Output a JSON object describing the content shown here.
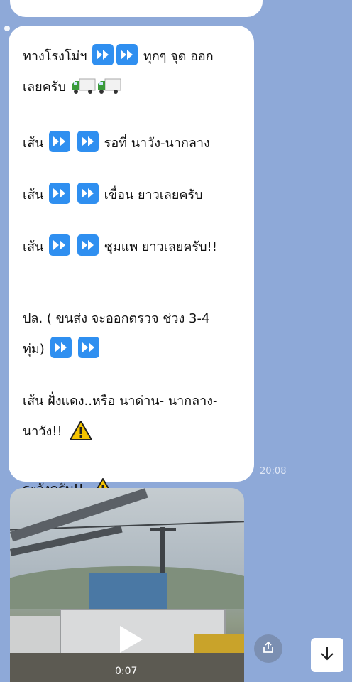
{
  "previous_message": {
    "partial_text": "",
    "time": ""
  },
  "message": {
    "line1_prefix": "ทางโรงโม่ฯ",
    "line1_suffix": "ทุกๆ จุด ออก",
    "line2": "เลยครับ",
    "route1_prefix": "เส้น",
    "route1_suffix": "รอที่ นาวัง-นากลาง",
    "route2_prefix": "เส้น",
    "route2_suffix": "เขื่อน ยาวเลยครับ",
    "route3_prefix": "เส้น",
    "route3_suffix": "ชุมแพ ยาวเลยครับ!!",
    "note_line1": "ปล. ( ขนส่ง จะออกตรวจ ช่วง 3-4",
    "note_line2": "ทุ่ม)",
    "route4_line1": " เส้น ฝั่งแดง..หรือ นาด่าน- นากลาง-",
    "route4_line2": "นาวัง!!",
    "closing": "ระวังครับ!!",
    "time": "20:08"
  },
  "video": {
    "duration": "0:07"
  },
  "icons": {
    "fast_forward": "fast-forward-icon",
    "truck": "delivery-truck-icon",
    "warning": "warning-icon",
    "share": "share-icon",
    "scroll_down": "arrow-down-icon",
    "play": "play-icon"
  },
  "colors": {
    "background": "#8ea9d8",
    "bubble": "#ffffff",
    "fast_forward_blue": "#2f8ff0",
    "warning_yellow": "#f5c400"
  }
}
